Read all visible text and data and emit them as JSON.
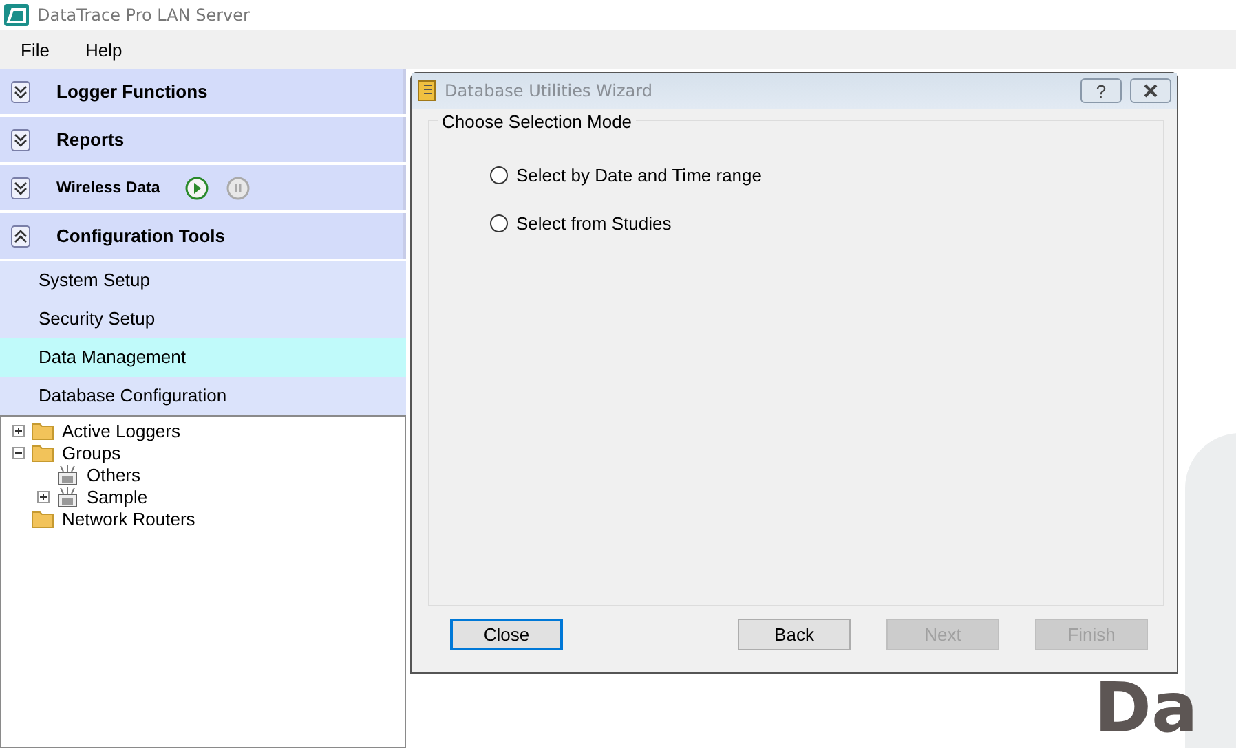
{
  "window": {
    "title": "DataTrace Pro LAN Server"
  },
  "menu": [
    "File",
    "Help"
  ],
  "sidebar": {
    "sections": [
      {
        "label": "Logger Functions",
        "expanded": false,
        "kind": "plain"
      },
      {
        "label": "Reports",
        "expanded": false,
        "kind": "plain"
      },
      {
        "label": "Wireless Data",
        "expanded": false,
        "kind": "wireless",
        "play_enabled": true,
        "pause_enabled": false
      },
      {
        "label": "Configuration Tools",
        "expanded": true,
        "kind": "plain"
      }
    ],
    "items": [
      {
        "label": "System Setup",
        "selected": false
      },
      {
        "label": "Security Setup",
        "selected": false
      },
      {
        "label": "Data Management",
        "selected": true
      },
      {
        "label": "Database Configuration",
        "selected": false
      }
    ]
  },
  "tree": [
    {
      "label": "Active Loggers",
      "kind": "folder",
      "expanded": false
    },
    {
      "label": "Groups",
      "kind": "folder",
      "expanded": true,
      "children": [
        {
          "label": "Others",
          "kind": "group"
        },
        {
          "label": "Sample",
          "kind": "group",
          "expanded": false
        }
      ]
    },
    {
      "label": "Network Routers",
      "kind": "folder"
    }
  ],
  "background_logo_text": "Da",
  "dialog": {
    "title": "Database Utilities Wizard",
    "help_label": "?",
    "group_title": "Choose Selection Mode",
    "options": [
      {
        "label": "Select by Date and Time range",
        "selected": false
      },
      {
        "label": "Select from Studies",
        "selected": false
      }
    ],
    "buttons": [
      {
        "label": "Close",
        "disabled": false,
        "focused": true
      },
      {
        "label": "Back",
        "disabled": false,
        "focused": false
      },
      {
        "label": "Next",
        "disabled": true,
        "focused": false
      },
      {
        "label": "Finish",
        "disabled": true,
        "focused": false
      }
    ]
  }
}
